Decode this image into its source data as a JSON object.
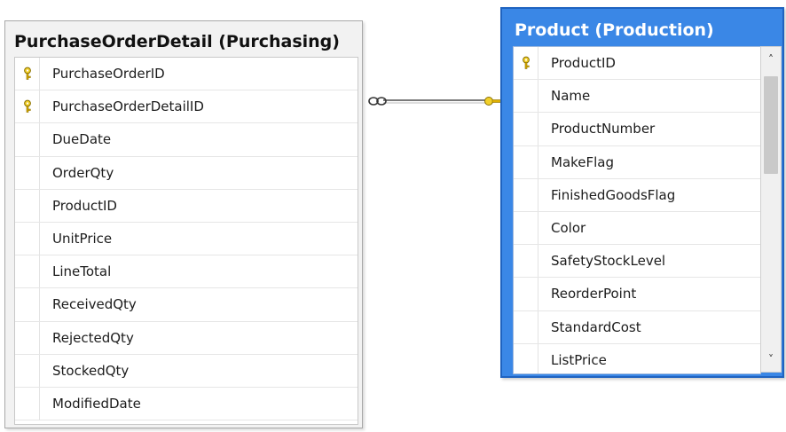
{
  "left_table": {
    "title": "PurchaseOrderDetail (Purchasing)",
    "columns": [
      {
        "name": "PurchaseOrderID",
        "key": true
      },
      {
        "name": "PurchaseOrderDetailID",
        "key": true
      },
      {
        "name": "DueDate",
        "key": false
      },
      {
        "name": "OrderQty",
        "key": false
      },
      {
        "name": "ProductID",
        "key": false
      },
      {
        "name": "UnitPrice",
        "key": false
      },
      {
        "name": "LineTotal",
        "key": false
      },
      {
        "name": "ReceivedQty",
        "key": false
      },
      {
        "name": "RejectedQty",
        "key": false
      },
      {
        "name": "StockedQty",
        "key": false
      },
      {
        "name": "ModifiedDate",
        "key": false
      }
    ]
  },
  "right_table": {
    "title": "Product (Production)",
    "selected": true,
    "columns": [
      {
        "name": "ProductID",
        "key": true
      },
      {
        "name": "Name",
        "key": false
      },
      {
        "name": "ProductNumber",
        "key": false
      },
      {
        "name": "MakeFlag",
        "key": false
      },
      {
        "name": "FinishedGoodsFlag",
        "key": false
      },
      {
        "name": "Color",
        "key": false
      },
      {
        "name": "SafetyStockLevel",
        "key": false
      },
      {
        "name": "ReorderPoint",
        "key": false
      },
      {
        "name": "StandardCost",
        "key": false
      },
      {
        "name": "ListPrice",
        "key": false
      }
    ]
  },
  "relationship": {
    "many_end": "∞",
    "one_end": "key-icon"
  },
  "icons": {
    "primary_key": "key-icon",
    "scroll_up": "chevron-up-icon",
    "scroll_down": "chevron-down-icon",
    "annotation": "arrow-left-icon"
  },
  "colors": {
    "selected_header": "#3a87e6",
    "key_gold": "#e0b000",
    "annotation_arrow": "#c0161b",
    "connector": "#7a7a7a"
  }
}
